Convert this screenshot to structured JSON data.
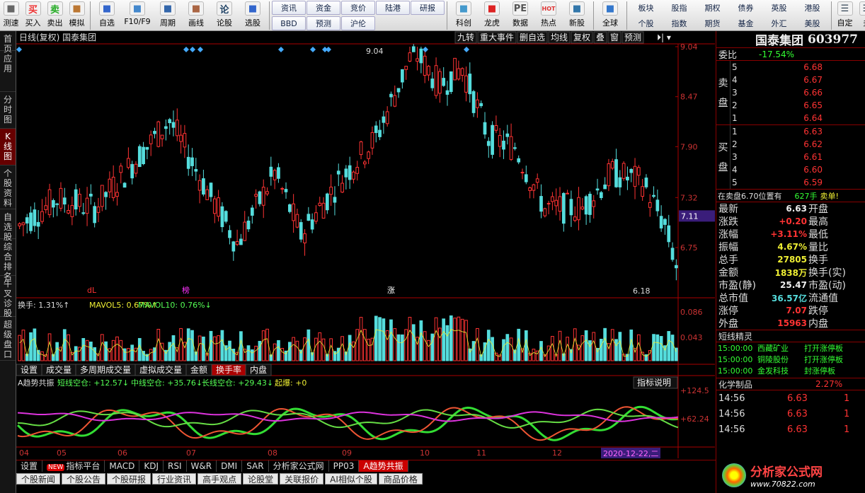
{
  "toolbar": {
    "left_buttons": [
      {
        "label": "测速",
        "icon": "speedtest-icon"
      },
      {
        "label": "买入",
        "icon": "buy-icon",
        "glyph": "买"
      },
      {
        "label": "卖出",
        "icon": "sell-icon",
        "glyph": "卖"
      },
      {
        "label": "模拟",
        "icon": "simulate-icon"
      },
      {
        "label": "自选",
        "icon": "favorites-icon"
      },
      {
        "label": "F10/F9",
        "icon": "f10-icon"
      },
      {
        "label": "周期",
        "icon": "period-icon"
      },
      {
        "label": "画线",
        "icon": "draw-line-icon"
      },
      {
        "label": "论股",
        "icon": "discuss-icon",
        "glyph": "论"
      },
      {
        "label": "选股",
        "icon": "stock-picker-icon"
      }
    ],
    "grid_a": [
      [
        "资讯",
        "资金",
        "竞价",
        "陆港"
      ],
      [
        "研报",
        "BBD",
        "预测",
        "沪伦"
      ]
    ],
    "mid_buttons": [
      {
        "label": "科创",
        "icon": "star-market-icon"
      },
      {
        "label": "龙虎",
        "icon": "dragon-tiger-icon"
      },
      {
        "label": "数据",
        "icon": "data-icon",
        "glyph": "PE"
      },
      {
        "label": "热点",
        "icon": "hot-icon",
        "glyph": "HOT"
      },
      {
        "label": "新股",
        "icon": "new-stock-icon"
      },
      {
        "label": "全球",
        "icon": "globe-icon"
      }
    ],
    "grid_b": [
      [
        "板块",
        "股指",
        "期权",
        "债券",
        "英股",
        "港股"
      ],
      [
        "个股",
        "指数",
        "期货",
        "基金",
        "外汇",
        "美股"
      ]
    ],
    "right_buttons": [
      {
        "label": "自定"
      },
      {
        "label": "多"
      }
    ]
  },
  "left_tabs": [
    {
      "label": "首页"
    },
    {
      "label": "应用"
    },
    {
      "label": "分时图"
    },
    {
      "label": "K线图",
      "active": true
    },
    {
      "label": "个股资料"
    },
    {
      "label": "自选股"
    },
    {
      "label": "综合排名"
    },
    {
      "label": "牛叉诊股"
    },
    {
      "label": "超级盘口"
    }
  ],
  "chart_header": {
    "title": "日线(复权)  国泰集团",
    "buttons": [
      "九转",
      "重大事件",
      "删自选",
      "均线",
      "复权",
      "叠",
      "窗",
      "预测"
    ]
  },
  "price_axis": [
    "9.04",
    "8.47",
    "7.90",
    "7.32",
    "6.75"
  ],
  "price_marker": "7.11",
  "annot": {
    "high": "9.04",
    "low": "6.18",
    "marks": [
      "dL",
      "榜",
      "涨"
    ]
  },
  "turnover": {
    "label": "换手: 1.31%↑",
    "mavol5": "MAVOL5: 0.67%↑",
    "mavol10": "MAVOL10: 0.76%↓",
    "axis": [
      "0.086",
      "0.043"
    ]
  },
  "vol_tabs": [
    "设置",
    "成交量",
    "多周期成交量",
    "虚拟成交量",
    "金额",
    "换手率",
    "内盘"
  ],
  "indicator": {
    "name": "A趋势共振",
    "short": "短线空仓: +12.57↓",
    "mid": "中线空仓: +35.76↓",
    "long": "长线空仓: +29.43↓",
    "start": "起爆: +0",
    "help": "指标说明",
    "axis": [
      "+124.5",
      "+62.24"
    ]
  },
  "months": [
    "04",
    "05",
    "06",
    "07",
    "08",
    "09",
    "10",
    "11",
    "12"
  ],
  "date_label": "2020-12-22,二",
  "bottom_tabs": [
    "设置",
    "平台",
    "MACD",
    "KDJ",
    "RSI",
    "W&R",
    "DMI",
    "SAR",
    "分析家公式网",
    "PP03",
    "A趋势共振"
  ],
  "new_badge": "NEW",
  "bottom_tab_extra": "指标平台",
  "news_tabs": [
    "个股新闻",
    "个股公告",
    "个股研报",
    "行业资讯",
    "高手观点",
    "论股堂",
    "关联报价",
    "AI相似个股",
    "商品价格"
  ],
  "quote": {
    "name": "国泰集团",
    "code": "603977",
    "weibi_label": "委比",
    "weibi": "-17.54%",
    "sell": [
      {
        "n": "5",
        "p": "6.68"
      },
      {
        "n": "4",
        "p": "6.67"
      },
      {
        "n": "3",
        "p": "6.66"
      },
      {
        "n": "2",
        "p": "6.65"
      },
      {
        "n": "1",
        "p": "6.64"
      }
    ],
    "buy": [
      {
        "n": "1",
        "p": "6.63"
      },
      {
        "n": "2",
        "p": "6.62"
      },
      {
        "n": "3",
        "p": "6.61"
      },
      {
        "n": "4",
        "p": "6.60"
      },
      {
        "n": "5",
        "p": "6.59"
      }
    ],
    "sell_label": "卖盘",
    "buy_label": "买盘",
    "notice": "在卖盘6.70位置有",
    "notice_qty": "627手",
    "notice_tail": "卖单!",
    "rows": [
      [
        "最新",
        "6.63",
        "开盘",
        ""
      ],
      [
        "涨跌",
        "+0.20",
        "最高",
        ""
      ],
      [
        "涨幅",
        "+3.11%",
        "最低",
        ""
      ],
      [
        "振幅",
        "4.67%",
        "量比",
        ""
      ],
      [
        "总手",
        "27805",
        "换手",
        ""
      ],
      [
        "金额",
        "1838万",
        "换手(实)",
        ""
      ],
      [
        "市盈(静)",
        "25.47",
        "市盈(动)",
        ""
      ],
      [
        "总市值",
        "36.57亿",
        "流通值",
        ""
      ],
      [
        "涨停",
        "7.07",
        "跌停",
        ""
      ],
      [
        "外盘",
        "15963",
        "内盘",
        ""
      ]
    ],
    "elf_title": "短线精灵",
    "elf": [
      {
        "t": "15:00:00",
        "n": "西藏矿业",
        "e": "打开涨停板"
      },
      {
        "t": "15:00:00",
        "n": "铜陵股份",
        "e": "打开涨停板"
      },
      {
        "t": "15:00:00",
        "n": "金发科技",
        "e": "封涨停板"
      }
    ],
    "sector": "化学制品",
    "sector_pct": "2.27%",
    "ticks": [
      {
        "t": "14:56",
        "p": "6.63",
        "v": "1"
      },
      {
        "t": "14:56",
        "p": "6.63",
        "v": "1"
      },
      {
        "t": "14:56",
        "p": "6.63",
        "v": "1"
      }
    ],
    "logo": "分析家公式网",
    "logo_url": "www.70822.com"
  }
}
